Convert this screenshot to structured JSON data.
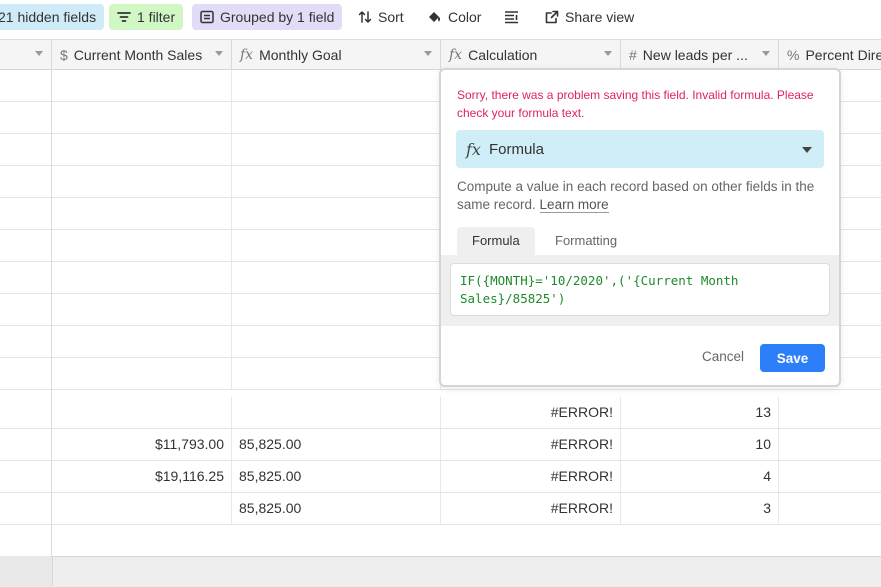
{
  "toolbar": {
    "hidden_fields": "21 hidden fields",
    "filter": "1 filter",
    "grouped": "Grouped by 1 field",
    "sort": "Sort",
    "color": "Color",
    "share": "Share view"
  },
  "columns": [
    {
      "label": "Current Month Sales",
      "icon": "currency-icon"
    },
    {
      "label": "Monthly Goal",
      "icon": "formula-icon"
    },
    {
      "label": "Calculation",
      "icon": "formula-icon"
    },
    {
      "label": "New leads per ...",
      "icon": "number-icon"
    },
    {
      "label": "Percent Dire",
      "icon": "percent-icon"
    }
  ],
  "rows": [
    {
      "sales": "",
      "goal": "",
      "calc": "#ERROR!",
      "leads": "13"
    },
    {
      "sales": "$11,793.00",
      "goal": "85,825.00",
      "calc": "#ERROR!",
      "leads": "10"
    },
    {
      "sales": "$19,116.25",
      "goal": "85,825.00",
      "calc": "#ERROR!",
      "leads": "4"
    },
    {
      "sales": "",
      "goal": "85,825.00",
      "calc": "#ERROR!",
      "leads": "3"
    }
  ],
  "popup": {
    "error": "Sorry, there was a problem saving this field. Invalid formula. Please check your formula text.",
    "type_label": "Formula",
    "description": "Compute a value in each record based on other fields in the same record.",
    "learn_more": "Learn more",
    "tab_formula": "Formula",
    "tab_formatting": "Formatting",
    "formula_text": "IF({MONTH}='10/2020',('{Current Month Sales}/85825')",
    "cancel": "Cancel",
    "save": "Save"
  }
}
